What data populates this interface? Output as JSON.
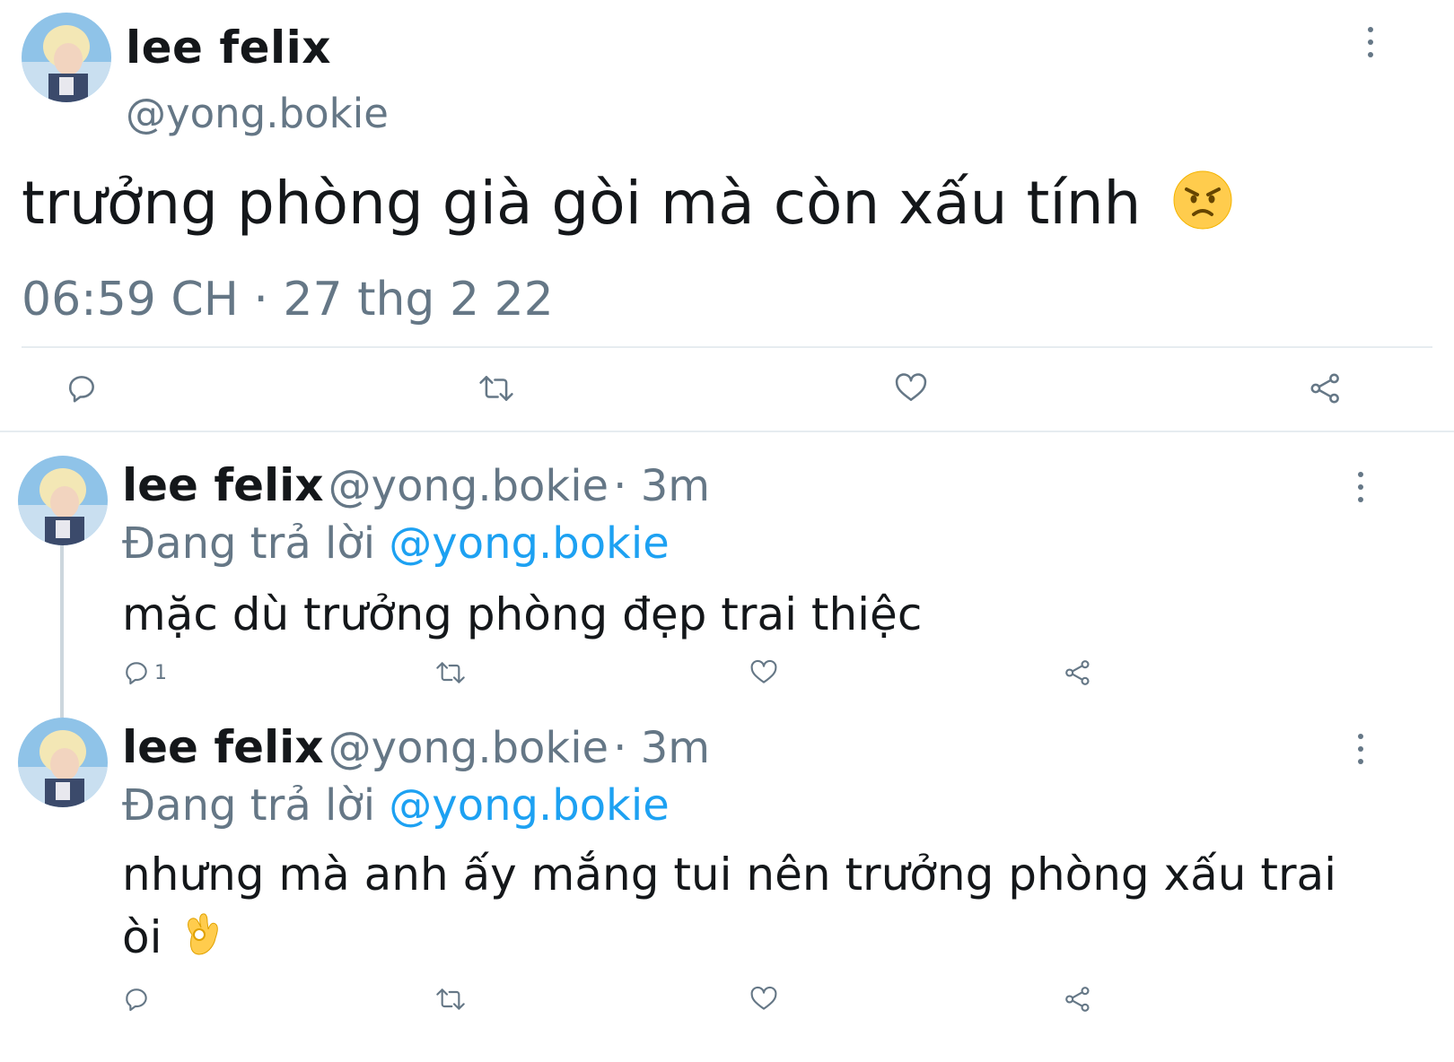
{
  "main_tweet": {
    "name": "lee felix",
    "handle": "@yong.bokie",
    "text": "trưởng phòng già gòi mà còn xấu tính",
    "emoji": "angry-face",
    "timestamp": "06:59 CH · 27 thg 2 22"
  },
  "replies": [
    {
      "name": "lee felix",
      "handle": "@yong.bokie",
      "time": "· 3m",
      "replying_label": "Đang trả lời",
      "replying_to": "@yong.bokie",
      "text": "mặc dù trưởng phòng đẹp trai thiệc",
      "reply_count": "1"
    },
    {
      "name": "lee felix",
      "handle": "@yong.bokie",
      "time": "· 3m",
      "replying_label": "Đang trả lời",
      "replying_to": "@yong.bokie",
      "text_line1": "nhưng mà anh ấy mắng tui nên trưởng phòng xấu trai",
      "text_line2": "òi",
      "emoji": "ok-hand",
      "reply_count": ""
    }
  ],
  "colors": {
    "text": "#14171a",
    "secondary": "#657786",
    "link": "#1da1f2",
    "divider": "#e6ecf0"
  }
}
